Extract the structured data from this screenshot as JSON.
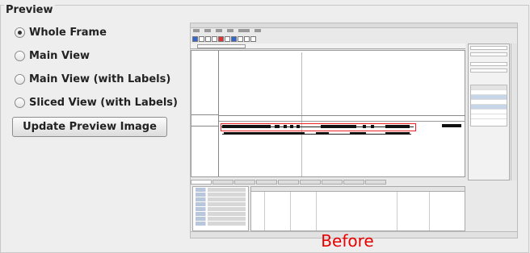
{
  "group": {
    "title": "Preview"
  },
  "options": [
    {
      "label": "Whole Frame",
      "selected": true
    },
    {
      "label": "Main View",
      "selected": false
    },
    {
      "label": "Main View (with Labels)",
      "selected": false
    },
    {
      "label": "Sliced View (with Labels)",
      "selected": false
    }
  ],
  "update_button": {
    "label": "Update Preview Image"
  },
  "preview": {
    "caption": "Before",
    "caption_color": "#e60000"
  }
}
